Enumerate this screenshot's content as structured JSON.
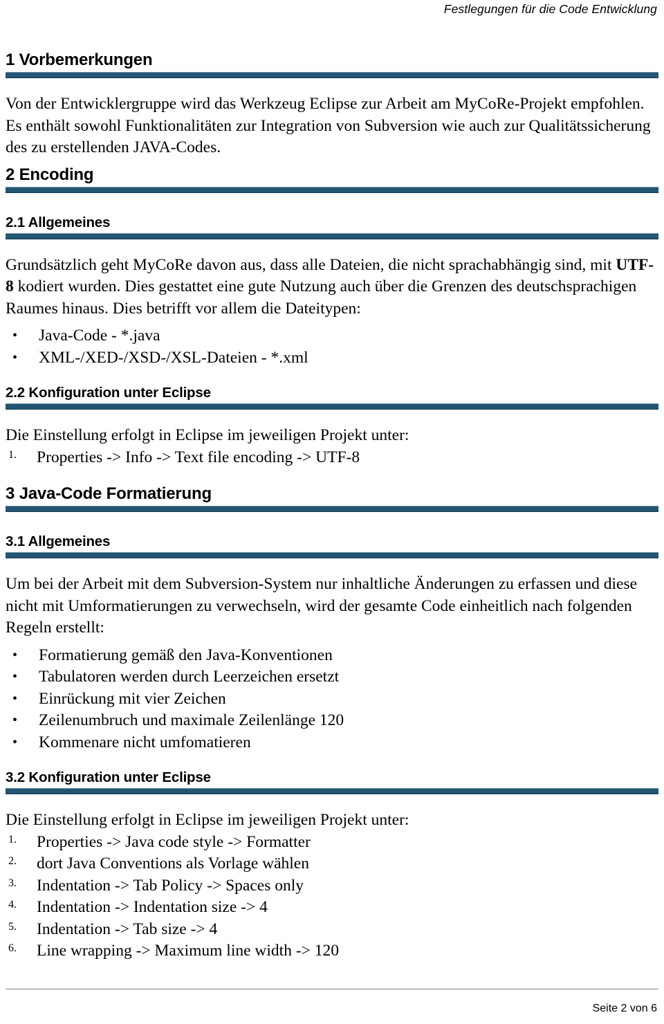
{
  "header": {
    "running_title": "Festlegungen für die Code Entwicklung"
  },
  "theme": {
    "heading_bar_color": "#235672",
    "heading_bar_highlight": "#6f93a6",
    "heading_bar_shadow": "#0e3950",
    "text_color": "#000000",
    "page_background": "#ffffff",
    "footer_rule_color": "#808080"
  },
  "sections": {
    "s1": {
      "heading": "1 Vorbemerkungen",
      "paragraph": "Von der Entwicklergruppe wird das Werkzeug Eclipse zur Arbeit am MyCoRe-Projekt empfohlen. Es enthält sowohl Funktionalitäten zur Integration von Subversion wie auch zur Qualitätssicherung des zu erstellenden JAVA-Codes."
    },
    "s2": {
      "heading": "2 Encoding",
      "s2_1": {
        "heading": "2.1 Allgemeines",
        "para_part1": "Grundsätzlich geht MyCoRe davon aus, dass alle Dateien, die nicht sprachabhängig sind, mit ",
        "para_bold": "UTF-8",
        "para_part2": " kodiert wurden. Dies gestattet eine gute Nutzung auch über die Grenzen des deutschsprachigen Raumes hinaus. Dies betrifft vor allem die Dateitypen:",
        "bullets": [
          "Java-Code - *.java",
          "XML-/XED-/XSD-/XSL-Dateien - *.xml"
        ]
      },
      "s2_2": {
        "heading": "2.2 Konfiguration unter Eclipse",
        "intro": "Die Einstellung erfolgt in Eclipse im jeweiligen Projekt unter:",
        "steps": [
          {
            "marker": "1.",
            "text": "Properties -> Info -> Text file encoding -> UTF-8"
          }
        ]
      }
    },
    "s3": {
      "heading": "3 Java-Code Formatierung",
      "s3_1": {
        "heading": "3.1 Allgemeines",
        "paragraph": "Um bei der Arbeit mit dem Subversion-System nur inhaltliche Änderungen zu erfassen und diese nicht mit Umformatierungen zu verwechseln, wird der gesamte Code einheitlich nach folgenden Regeln erstellt:",
        "bullets": [
          "Formatierung gemäß den Java-Konventionen",
          "Tabulatoren werden durch Leerzeichen ersetzt",
          "Einrückung mit vier Zeichen",
          "Zeilenumbruch und maximale Zeilenlänge 120",
          "Kommenare nicht umfomatieren"
        ]
      },
      "s3_2": {
        "heading": "3.2 Konfiguration unter Eclipse",
        "intro": "Die Einstellung erfolgt in Eclipse im jeweiligen Projekt unter:",
        "steps": [
          {
            "marker": "1.",
            "text": "Properties -> Java code style -> Formatter"
          },
          {
            "marker": "2.",
            "text": "dort Java Conventions als Vorlage wählen"
          },
          {
            "marker": "3.",
            "text": "Indentation -> Tab Policy -> Spaces only"
          },
          {
            "marker": "4.",
            "text": "Indentation -> Indentation size -> 4"
          },
          {
            "marker": "5.",
            "text": "Indentation -> Tab size -> 4"
          },
          {
            "marker": "6.",
            "text": "Line wrapping -> Maximum line width -> 120"
          }
        ]
      }
    }
  },
  "bullet_glyph": "•",
  "footer": {
    "page_label": "Seite 2 von 6"
  }
}
